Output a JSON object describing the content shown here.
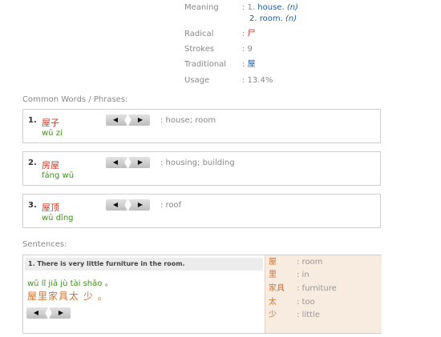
{
  "info": {
    "meaning_label": "Meaning",
    "meaning_1_prefix": ": 1.",
    "meaning_1_word": "house.",
    "meaning_1_pos": "(n)",
    "meaning_2_prefix": "2.",
    "meaning_2_word": "room.",
    "meaning_2_pos": "(n)",
    "radical_label": "Radical",
    "radical_sep": ":",
    "radical_value": "尸",
    "strokes_label": "Strokes",
    "strokes_value": ": 9",
    "traditional_label": "Traditional",
    "traditional_sep": ":",
    "traditional_value": "屋",
    "usage_label": "Usage",
    "usage_value": ": 13.4%"
  },
  "common_words_header": "Common Words / Phrases:",
  "words": [
    {
      "num": "1.",
      "chars": "屋子",
      "pinyin": "wū zi",
      "meaning": ":  house; room"
    },
    {
      "num": "2.",
      "chars": "房屋",
      "pinyin": "fáng wū",
      "meaning": ":  housing; building"
    },
    {
      "num": "3.",
      "chars": "屋顶",
      "pinyin": "wū dǐng",
      "meaning": ":  roof"
    }
  ],
  "audio": {
    "prev_glyph": "◀",
    "next_glyph": "▶"
  },
  "sentences_header": "Sentences:",
  "sentence": {
    "title": "1. There is very little furniture in the room.",
    "pinyin": "wū lǐ jiā jù tài shǎo 。",
    "chinese": "屋里家具太 少 。",
    "glossary": [
      {
        "char": "屋",
        "meaning": ": room"
      },
      {
        "char": "里",
        "meaning": ": in"
      },
      {
        "char": "家具",
        "meaning": ": furniture"
      },
      {
        "char": "太",
        "meaning": ": too"
      },
      {
        "char": "少",
        "meaning": ": little"
      }
    ]
  }
}
